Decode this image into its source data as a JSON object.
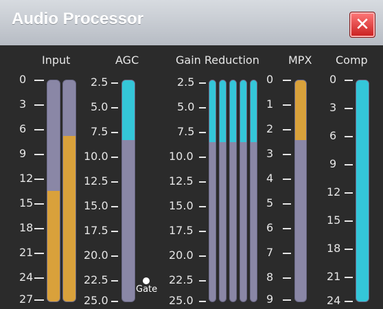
{
  "app": {
    "title": "Audio Processor",
    "close_icon": "close-icon"
  },
  "headers": {
    "input": "Input",
    "agc": "AGC",
    "gain_reduction": "Gain Reduction",
    "mpx": "MPX",
    "comp": "Comp"
  },
  "scales": {
    "input": [
      "0",
      "3",
      "6",
      "9",
      "12",
      "15",
      "18",
      "21",
      "24",
      "27"
    ],
    "agc": [
      "2.5",
      "5.0",
      "7.5",
      "10.0",
      "12.5",
      "15.0",
      "17.5",
      "20.0",
      "22.5",
      "25.0"
    ],
    "gain_reduction": [
      "2.5",
      "5.0",
      "7.5",
      "10.0",
      "12.5",
      "15.0",
      "17.5",
      "20.0",
      "22.5",
      "25.0"
    ],
    "mpx": [
      "0",
      "1",
      "2",
      "3",
      "4",
      "5",
      "6",
      "7",
      "8",
      "9"
    ],
    "comp": [
      "0",
      "3",
      "6",
      "9",
      "12",
      "15",
      "18",
      "21",
      "24"
    ]
  },
  "gate": {
    "label": "Gate"
  },
  "colors": {
    "meter_bg": "#8a87a6",
    "orange": "#d9a13b",
    "cyan": "#34c6d9",
    "panel": "#2b2b2b"
  },
  "levels": {
    "input_left_fill": 0.5,
    "input_right_fill": 0.75,
    "agc_fill": 0.27,
    "gr_fill": 0.28,
    "mpx_fill": 0.27,
    "comp_fill": 1.0
  }
}
